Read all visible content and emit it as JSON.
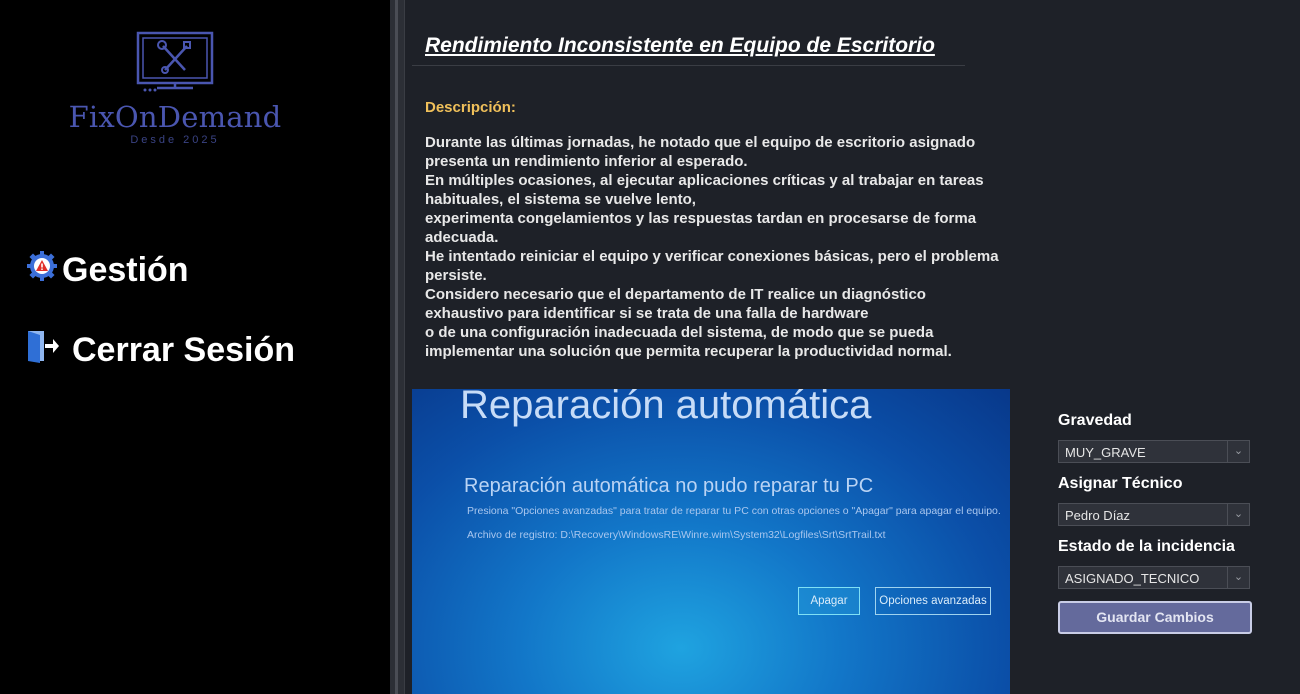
{
  "brand": {
    "name": "FixOnDemand",
    "tagline": "Desde 2025"
  },
  "sidebar": {
    "items": [
      {
        "label": "Gestión",
        "icon": "gear-warning-icon"
      },
      {
        "label": "Cerrar Sesión",
        "icon": "logout-door-icon"
      }
    ]
  },
  "incident": {
    "title": "Rendimiento Inconsistente en Equipo de Escritorio",
    "description_label": "Descripción:",
    "description": "Durante las últimas jornadas, he notado que el equipo de escritorio asignado\npresenta un rendimiento inferior al esperado.\nEn múltiples ocasiones, al ejecutar aplicaciones críticas y al trabajar en tareas\nhabituales, el sistema se vuelve lento,\nexperimenta congelamientos y las respuestas tardan en procesarse de forma\nadecuada.\nHe intentado reiniciar el equipo y verificar conexiones básicas, pero el problema\npersiste.\nConsidero necesario que el departamento de IT realice un diagnóstico\nexhaustivo para identificar si se trata de una falla de hardware\no de una configuración inadecuada del sistema, de modo que se pueda\nimplementar una solución que permita recuperar la productividad normal."
  },
  "photo": {
    "title": "Reparación automática",
    "subtitle": "Reparación automática no pudo reparar tu PC",
    "line1": "Presiona \"Opciones avanzadas\" para tratar de reparar tu PC con otras opciones o \"Apagar\" para apagar el equipo.",
    "line2": "Archivo de registro: D:\\Recovery\\WindowsRE\\Winre.wim\\System32\\Logfiles\\Srt\\SrtTrail.txt",
    "btn_apagar": "Apagar",
    "btn_opciones": "Opciones avanzadas"
  },
  "form": {
    "gravedad_label": "Gravedad",
    "gravedad_value": "MUY_GRAVE",
    "tecnico_label": "Asignar Técnico",
    "tecnico_value": "Pedro Díaz",
    "estado_label": "Estado de la incidencia",
    "estado_value": "ASIGNADO_TECNICO",
    "save_label": "Guardar Cambios"
  },
  "colors": {
    "accent": "#646a9c",
    "brand": "#4a56b0",
    "label_highlight": "#f0c05a",
    "background": "#1e2128",
    "sidebar": "#000000"
  }
}
